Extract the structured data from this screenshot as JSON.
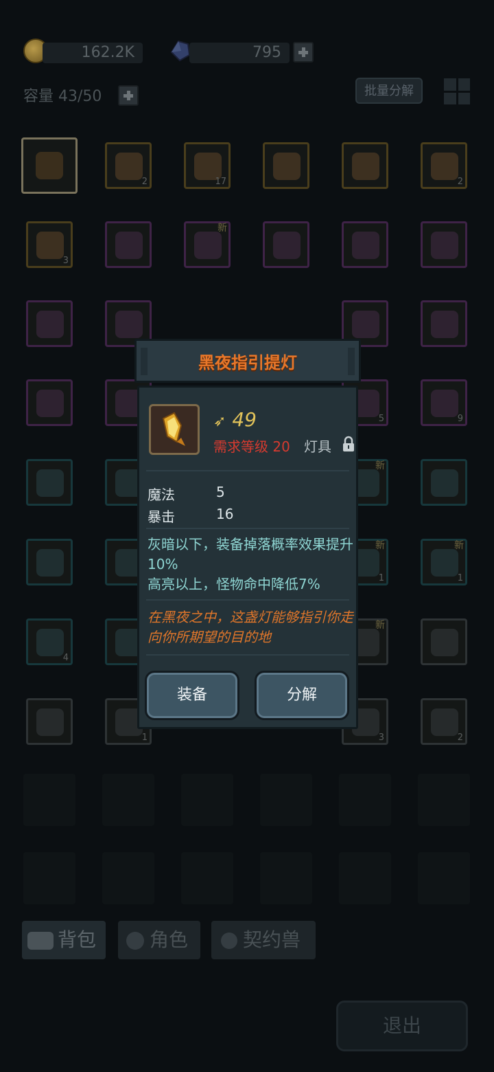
{
  "currency": {
    "gold": "162.2K",
    "gems": "795"
  },
  "inventory": {
    "capacity_label": "容量 43/50",
    "batch_button": "批量分解"
  },
  "slots": [
    {
      "row": 0,
      "col": 0,
      "rarity": "selected",
      "count": "",
      "new": false
    },
    {
      "row": 0,
      "col": 1,
      "rarity": "gold",
      "count": "2",
      "new": false
    },
    {
      "row": 0,
      "col": 2,
      "rarity": "gold",
      "count": "17",
      "new": false
    },
    {
      "row": 0,
      "col": 3,
      "rarity": "gold",
      "count": "",
      "new": false
    },
    {
      "row": 0,
      "col": 4,
      "rarity": "gold",
      "count": "",
      "new": false
    },
    {
      "row": 0,
      "col": 5,
      "rarity": "gold",
      "count": "2",
      "new": false
    },
    {
      "row": 1,
      "col": 0,
      "rarity": "gold",
      "count": "3",
      "new": false
    },
    {
      "row": 1,
      "col": 1,
      "rarity": "purple",
      "count": "",
      "new": false
    },
    {
      "row": 1,
      "col": 2,
      "rarity": "purple",
      "count": "",
      "new": true
    },
    {
      "row": 1,
      "col": 3,
      "rarity": "purple",
      "count": "",
      "new": false
    },
    {
      "row": 1,
      "col": 4,
      "rarity": "purple",
      "count": "",
      "new": false
    },
    {
      "row": 1,
      "col": 5,
      "rarity": "purple",
      "count": "",
      "new": false
    },
    {
      "row": 2,
      "col": 0,
      "rarity": "purple",
      "count": "",
      "new": false
    },
    {
      "row": 2,
      "col": 1,
      "rarity": "purple",
      "count": "",
      "new": false
    },
    {
      "row": 2,
      "col": 4,
      "rarity": "purple",
      "count": "",
      "new": false
    },
    {
      "row": 2,
      "col": 5,
      "rarity": "purple",
      "count": "",
      "new": false
    },
    {
      "row": 3,
      "col": 0,
      "rarity": "purple",
      "count": "",
      "new": false
    },
    {
      "row": 3,
      "col": 1,
      "rarity": "purple",
      "count": "",
      "new": false
    },
    {
      "row": 3,
      "col": 4,
      "rarity": "purple",
      "count": "5",
      "new": false
    },
    {
      "row": 3,
      "col": 5,
      "rarity": "purple",
      "count": "9",
      "new": false
    },
    {
      "row": 4,
      "col": 0,
      "rarity": "teal",
      "count": "",
      "new": false
    },
    {
      "row": 4,
      "col": 1,
      "rarity": "teal",
      "count": "",
      "new": false
    },
    {
      "row": 4,
      "col": 4,
      "rarity": "teal",
      "count": "",
      "new": true
    },
    {
      "row": 4,
      "col": 5,
      "rarity": "teal",
      "count": "",
      "new": false
    },
    {
      "row": 5,
      "col": 0,
      "rarity": "teal",
      "count": "",
      "new": false
    },
    {
      "row": 5,
      "col": 1,
      "rarity": "teal",
      "count": "",
      "new": false
    },
    {
      "row": 5,
      "col": 4,
      "rarity": "teal",
      "count": "1",
      "new": true
    },
    {
      "row": 5,
      "col": 5,
      "rarity": "teal",
      "count": "1",
      "new": true
    },
    {
      "row": 6,
      "col": 0,
      "rarity": "teal",
      "count": "4",
      "new": false
    },
    {
      "row": 6,
      "col": 1,
      "rarity": "teal",
      "count": "",
      "new": false
    },
    {
      "row": 6,
      "col": 4,
      "rarity": "gray",
      "count": "",
      "new": true
    },
    {
      "row": 6,
      "col": 5,
      "rarity": "gray",
      "count": "",
      "new": false
    },
    {
      "row": 7,
      "col": 0,
      "rarity": "gray",
      "count": "",
      "new": false
    },
    {
      "row": 7,
      "col": 1,
      "rarity": "gray",
      "count": "1",
      "new": false
    },
    {
      "row": 7,
      "col": 4,
      "rarity": "gray",
      "count": "3",
      "new": false
    },
    {
      "row": 7,
      "col": 5,
      "rarity": "gray",
      "count": "2",
      "new": false
    }
  ],
  "new_tag": "新",
  "tabs": {
    "bag": "背包",
    "character": "角色",
    "pet": "契约兽"
  },
  "exit_button": "退出",
  "item_popup": {
    "name": "黑夜指引提灯",
    "level": "49",
    "requirement": "需求等级 20",
    "type": "灯具",
    "stats": [
      {
        "name": "魔法",
        "value": "5"
      },
      {
        "name": "暴击",
        "value": "16"
      }
    ],
    "effect_1": "灰暗以下，装备掉落概率效果提升10%",
    "effect_2": "高亮以上，怪物命中降低7%",
    "flavor": "在黑夜之中，这盏灯能够指引你走向你所期望的目的地",
    "equip_button": "装备",
    "disassemble_button": "分解"
  },
  "colors": {
    "title_orange": "#e8772a",
    "requirement_red": "#d63a2f",
    "effect_teal": "#8fd6d3",
    "level_gold": "#e2c35a"
  }
}
